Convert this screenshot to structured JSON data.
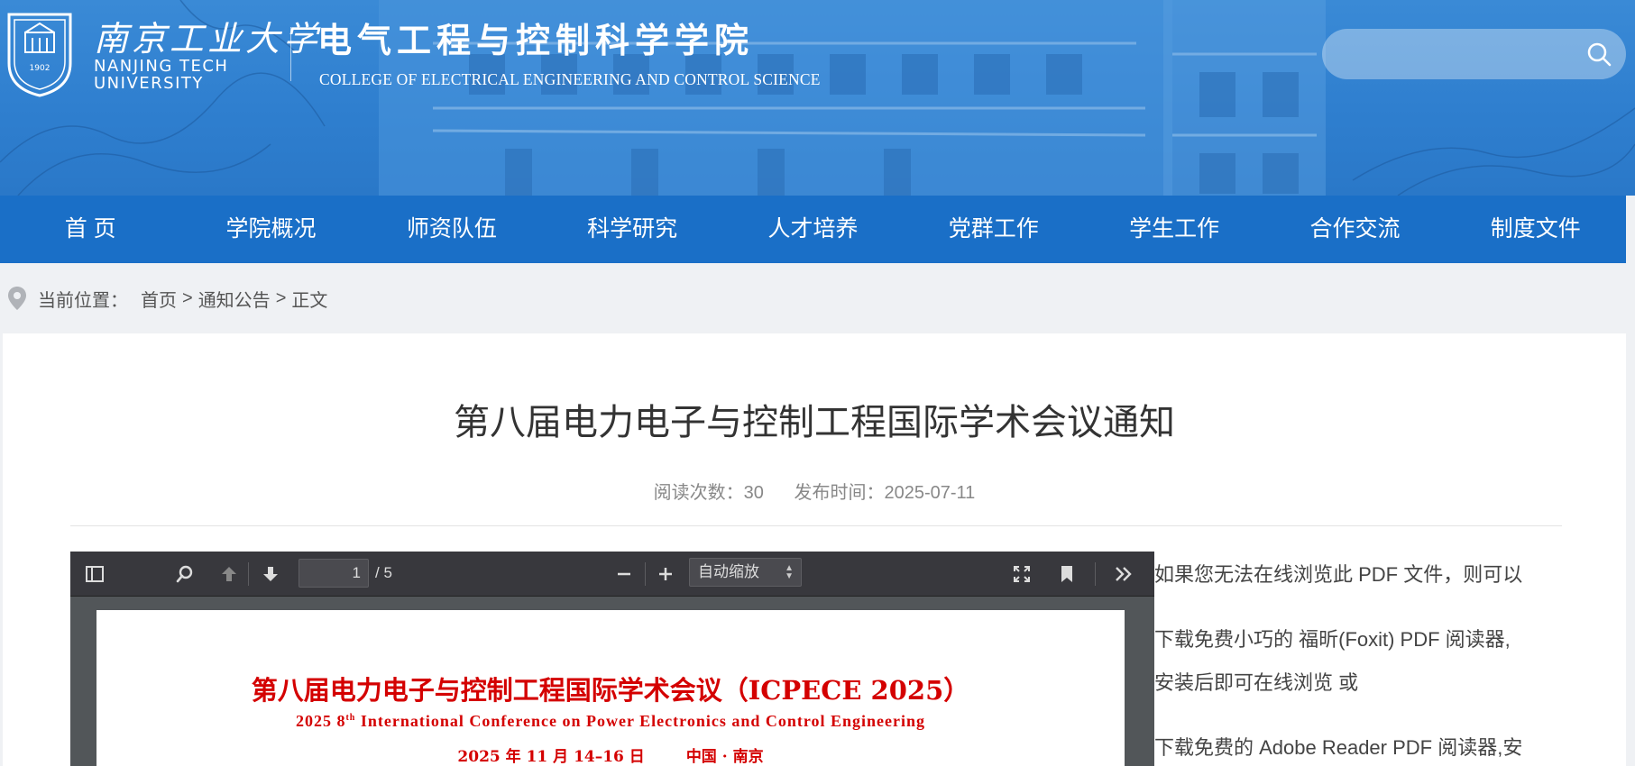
{
  "header": {
    "university_cn": "南京工业大学",
    "university_en_line1": "NANJING TECH",
    "university_en_line2": "UNIVERSITY",
    "college_cn": "电气工程与控制科学学院",
    "college_en": "COLLEGE OF ELECTRICAL ENGINEERING AND CONTROL SCIENCE",
    "search": {
      "placeholder": "",
      "icon": "search-icon"
    }
  },
  "nav": {
    "items": [
      {
        "label": "首 页"
      },
      {
        "label": "学院概况"
      },
      {
        "label": "师资队伍"
      },
      {
        "label": "科学研究"
      },
      {
        "label": "人才培养"
      },
      {
        "label": "党群工作"
      },
      {
        "label": "学生工作"
      },
      {
        "label": "合作交流"
      },
      {
        "label": "制度文件"
      }
    ]
  },
  "breadcrumb": {
    "prefix": "当前位置：",
    "items": [
      "首页",
      "通知公告",
      "正文"
    ],
    "separator": ">"
  },
  "article": {
    "title": "第八届电力电子与控制工程国际学术会议通知",
    "views_label": "阅读次数：30",
    "published_label": "发布时间：2025-07-11"
  },
  "pdf_viewer": {
    "page_current": "1",
    "page_total": "/ 5",
    "zoom": "自动缩放",
    "doc": {
      "title": "第八届电力电子与控制工程国际学术会议（ICPECE 2025）",
      "subtitle_pre": "2025 8",
      "subtitle_sup": "th",
      "subtitle_post": " International Conference on Power Electronics and Control Engineering",
      "date": "2025 年 11 月 14–16 日",
      "location": "中国 · 南京"
    }
  },
  "side_note": {
    "line1": "如果您无法在线浏览此 PDF 文件，则可以",
    "line2": "下载免费小巧的 福昕(Foxit) PDF 阅读器,",
    "line3": "安装后即可在线浏览  或",
    "line4": "下载免费的 Adobe Reader PDF 阅读器,安"
  },
  "colors": {
    "nav_bg": "#1a6fc7",
    "banner_bg": "#2f7fcf",
    "pdf_toolbar": "#38383d",
    "doc_red": "#d40000"
  }
}
